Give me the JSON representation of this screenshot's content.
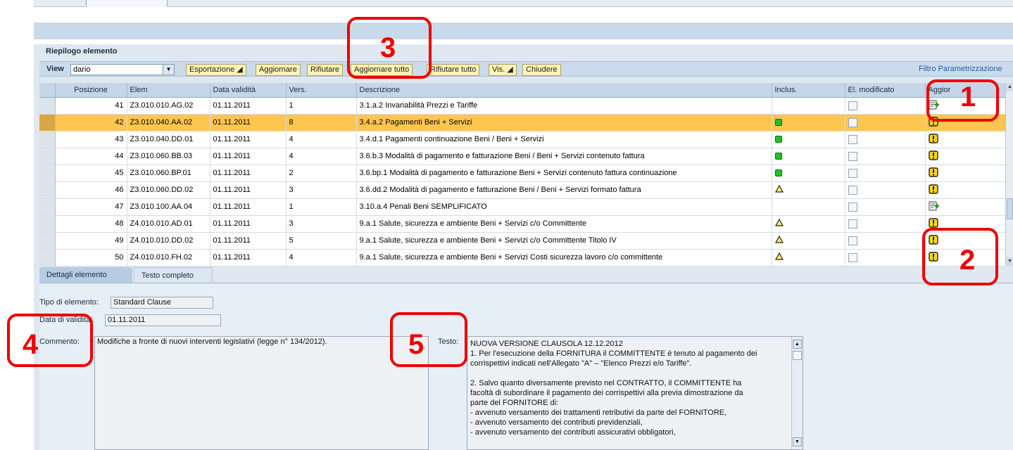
{
  "panel": {
    "title": "Riepilogo elemento"
  },
  "toolbar": {
    "view_label": "View",
    "view_value": "dario",
    "buttons": {
      "esportazione": "Esportazione ◢",
      "aggiornare": "Aggiornare",
      "rifiutare": "Rifiutare",
      "aggiornare_tutto": "Aggiornare tutto",
      "rifiutare_tutto": "Rifiutare tutto",
      "vis": "Vis. ◢",
      "chiudere": "Chiudere"
    },
    "filter_link": "Filtro  Parametrizzazione"
  },
  "grid": {
    "columns": [
      "Posizione",
      "Elem",
      "Data validità",
      "Vers.",
      "Descrizione",
      "Inclus.",
      "El. modificato",
      "Aggior"
    ],
    "rows": [
      {
        "pos": "41",
        "elem": "Z3.010.010.AG.02",
        "data": "01.11.2011",
        "vers": "1",
        "desc": "3.1.a.2 Invariabilità Prezzi e Tariffe",
        "inclus": "none",
        "aggior": "add-doc-icon",
        "selected": false
      },
      {
        "pos": "42",
        "elem": "Z3.010.040.AA.02",
        "data": "01.11.2011",
        "vers": "8",
        "desc": "3.4.a.2 Pagamenti Beni + Servizi",
        "inclus": "green",
        "aggior": "warning-icon",
        "selected": true
      },
      {
        "pos": "43",
        "elem": "Z3.010.040.DD.01",
        "data": "01.11.2011",
        "vers": "4",
        "desc": "3.4.d.1 Pagamenti continuazione Beni / Beni + Servizi",
        "inclus": "green",
        "aggior": "warning-icon",
        "selected": false
      },
      {
        "pos": "44",
        "elem": "Z3.010.060.BB.03",
        "data": "01.11.2011",
        "vers": "4",
        "desc": "3.6.b.3 Modalità di pagamento e fatturazione Beni / Beni + Servizi contenuto fattura",
        "inclus": "green",
        "aggior": "warning-icon",
        "selected": false
      },
      {
        "pos": "45",
        "elem": "Z3.010.060.BP.01",
        "data": "01.11.2011",
        "vers": "2",
        "desc": "3.6.bp.1 Modalità di pagamento e fatturazione Beni + Servizi contenuto fattura continuazione",
        "inclus": "green",
        "aggior": "warning-icon",
        "selected": false
      },
      {
        "pos": "46",
        "elem": "Z3.010.060.DD.02",
        "data": "01.11.2011",
        "vers": "3",
        "desc": "3.6.dd.2 Modalità di pagamento e fatturazione Beni / Beni + Servizi formato fattura",
        "inclus": "yellow",
        "aggior": "warning-icon",
        "selected": false
      },
      {
        "pos": "47",
        "elem": "Z3.010.100.AA.04",
        "data": "01.11.2011",
        "vers": "1",
        "desc": "3.10.a.4 Penali Beni SEMPLIFICATO",
        "inclus": "none",
        "aggior": "add-doc-icon",
        "selected": false
      },
      {
        "pos": "48",
        "elem": "Z4.010.010.AD.01",
        "data": "01.11.2011",
        "vers": "3",
        "desc": "9.a.1 Salute, sicurezza e ambiente Beni + Servizi c/o Committente",
        "inclus": "yellow",
        "aggior": "warning-icon",
        "selected": false
      },
      {
        "pos": "49",
        "elem": "Z4.010.010.DD.02",
        "data": "01.11.2011",
        "vers": "5",
        "desc": "9.a.1 Salute, sicurezza e ambiente Beni + Servizi c/o Committente Titolo IV",
        "inclus": "yellow",
        "aggior": "warning-icon",
        "selected": false
      },
      {
        "pos": "50",
        "elem": "Z4.010.010.FH.02",
        "data": "01.11.2011",
        "vers": "4",
        "desc": "9.a.1 Salute, sicurezza e ambiente Beni + Servizi Costi sicurezza lavoro c/o committente",
        "inclus": "yellow",
        "aggior": "warning-icon",
        "selected": false
      }
    ]
  },
  "detail_tabs": {
    "dettagli": "Dettagli elemento",
    "testo": "Testo completo"
  },
  "detail": {
    "tipo_label": "Tipo di elemento:",
    "tipo_value": "Standard Clause",
    "data_label": "Data di validità:",
    "data_value": "01.11.2011",
    "commento_label": "Commento:",
    "commento_value": "Modifiche a fronte di nuovi interventi legislativi (legge n° 134/2012).",
    "testo_label": "Testo:",
    "testo_lines": [
      "NUOVA VERSIONE CLAUSOLA 12.12.2012",
      "1. Per l'esecuzione della FORNITURA il COMMITTENTE è tenuto al pagamento dei",
      "corrispettivi indicati nell'Allegato \"A\" – \"Elenco Prezzi e/o Tariffe\".",
      "",
      "2. Salvo quanto diversamente previsto nel CONTRATTO, il COMMITTENTE ha",
      "facoltà di subordinare il pagamento dei corrispettivi alla previa dimostrazione da",
      "parte del FORNITORE di:",
      "- avvenuto versamento dei trattamenti retributivi da parte del FORNITORE,",
      "- avvenuto versamento dei contributi previdenziali,",
      "- avvenuto versamento dei contributi assicurativi obbligatori,"
    ]
  },
  "annotations": {
    "n1": "1",
    "n2": "2",
    "n3": "3",
    "n4": "4",
    "n5": "5"
  },
  "colors": {
    "accent_red": "#ee0000",
    "selected_row": "#ffc64f",
    "toolbar_button": "#fcf3b4"
  }
}
